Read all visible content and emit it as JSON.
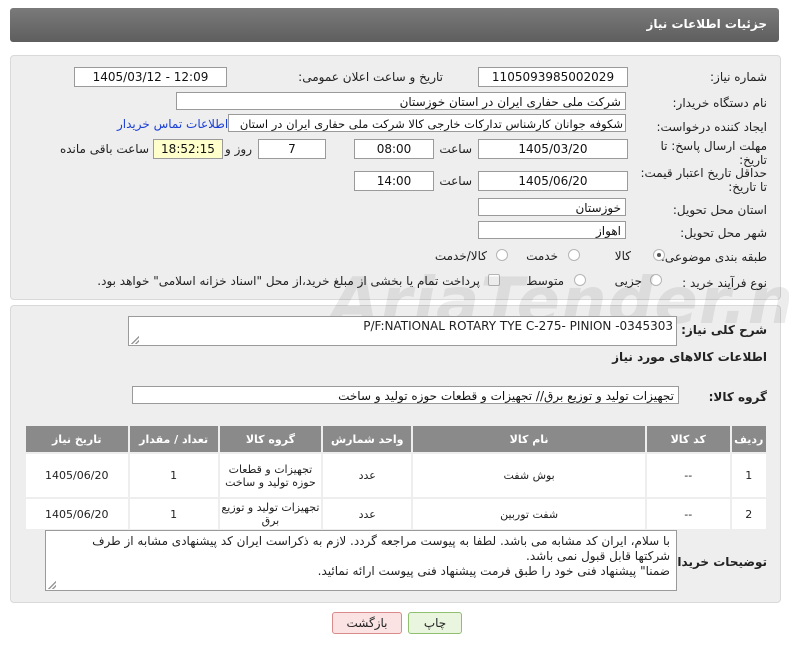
{
  "header": {
    "title": "جزئیات اطلاعات نیاز"
  },
  "form": {
    "need_number_label": "شماره نیاز:",
    "need_number": "1105093985002029",
    "announce_label": "تاریخ و ساعت اعلان عمومی:",
    "announce_value": "1405/03/12 - 12:09",
    "buyer_org_label": "نام دستگاه خریدار:",
    "buyer_org": "شرکت ملی حفاری ایران در استان خوزستان",
    "creator_label": "ایجاد کننده درخواست:",
    "creator": "شکوفه جوانان کارشناس تدارکات خارجی کالا شرکت ملی حفاری ایران در استان",
    "contact_link": "اطلاعات تماس خریدار",
    "deadline_label_1": "مهلت ارسال پاسخ: تا",
    "deadline_label_2": "تاریخ:",
    "deadline_date": "1405/03/20",
    "time_word": "ساعت",
    "deadline_time": "08:00",
    "days_value": "7",
    "days_word": "روز و",
    "remaining_time": "18:52:15",
    "remaining_word": "ساعت باقی مانده",
    "validity_label_1": "حداقل تاریخ اعتبار قیمت:",
    "validity_label_2": "تا تاریخ:",
    "validity_date": "1405/06/20",
    "validity_time": "14:00",
    "province_label": "استان محل تحویل:",
    "province": "خوزستان",
    "city_label": "شهر محل تحویل:",
    "city": "اهواز",
    "category_label": "طبقه بندی موضوعی:",
    "category_options": [
      "کالا",
      "خدمت",
      "کالا/خدمت"
    ],
    "category_selected": "کالا",
    "purchase_label": "نوع فرآیند خرید :",
    "purchase_options": [
      "جزیی",
      "متوسط"
    ],
    "payment_note": "پرداخت تمام یا بخشی از مبلغ خرید،از محل \"اسناد خزانه اسلامی\" خواهد بود."
  },
  "watermark": "AriaTender.net",
  "summary": {
    "label": "شرح کلی نیاز:",
    "value": "P/F:NATIONAL ROTARY TYE C-275- PINION -0345303"
  },
  "goods_info_title": "اطلاعات کالاهای مورد نیاز",
  "goods_group": {
    "label": "گروه کالا:",
    "value": "تجهیزات تولید و توزیع برق// تجهیزات و قطعات حوزه تولید و ساخت"
  },
  "table": {
    "headers": [
      "ردیف",
      "کد کالا",
      "نام کالا",
      "واحد شمارش",
      "گروه کالا",
      "تعداد / مقدار",
      "تاریخ نیاز"
    ],
    "rows": [
      {
        "row": "1",
        "code": "--",
        "name": "بوش شفت",
        "unit": "عدد",
        "group": "تجهیزات و قطعات حوزه تولید و ساخت",
        "qty": "1",
        "date": "1405/06/20"
      },
      {
        "row": "2",
        "code": "--",
        "name": "شفت توربین",
        "unit": "عدد",
        "group": "تجهیزات تولید و توزیع برق",
        "qty": "1",
        "date": "1405/06/20"
      }
    ]
  },
  "buyer_notes": {
    "label": "توضیحات خریدار:",
    "lines": [
      "با سلام، ایران کد مشابه می باشد. لطفا به پیوست مراجعه گردد. لازم به ذکراست ایران کد پیشنهادی مشابه از طرف",
      "شرکتها قابل قبول نمی باشد.",
      "ضمنا\" پیشنهاد فنی خود را طبق فرمت پیشنهاد فنی پیوست ارائه نمائید."
    ]
  },
  "buttons": {
    "print": "چاپ",
    "back": "بازگشت"
  }
}
